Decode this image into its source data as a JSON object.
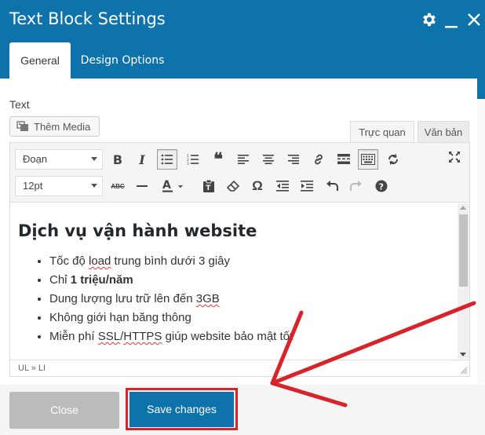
{
  "dialog": {
    "title": "Text Block Settings",
    "tabs": [
      "General",
      "Design Options"
    ]
  },
  "field": {
    "label": "Text"
  },
  "media_button": {
    "label": "Thêm Media",
    "icon": "media-icon"
  },
  "editor_tabs": {
    "visual": "Trực quan",
    "text": "Văn bản"
  },
  "toolbar": {
    "paragraph_format": "Đoạn",
    "font_size": "12pt",
    "row1_icons": [
      "bold-icon",
      "italic-icon",
      "bullet-list-icon",
      "numbered-list-icon",
      "blockquote-icon",
      "align-left-icon",
      "align-center-icon",
      "align-right-icon",
      "link-icon",
      "read-more-icon",
      "toolbar-toggle-icon",
      "refresh-icon",
      "fullscreen-icon"
    ],
    "row2_icons": [
      "strikethrough-icon",
      "horizontal-line-icon",
      "text-color-icon",
      "paste-text-icon",
      "clear-format-icon",
      "special-char-icon",
      "outdent-icon",
      "indent-icon",
      "undo-icon",
      "redo-icon",
      "help-icon"
    ],
    "bold_glyph": "B",
    "italic_glyph": "I",
    "strike_glyph": "ABC",
    "omega_glyph": "Ω",
    "quote_glyph": "❝",
    "help_glyph": "?"
  },
  "content": {
    "heading": "Dịch vụ vận hành website",
    "items": [
      {
        "before": "Tốc độ ",
        "squiggle": "load",
        "after": " trung bình dưới 3 giây"
      },
      {
        "before": "Chỉ ",
        "bold": "1 triệu/năm"
      },
      {
        "before": "Dung lượng lưu trữ lên đến ",
        "squiggle": "3GB"
      },
      {
        "before": "Không giới hạn băng thông"
      },
      {
        "before": "Miễn phí ",
        "squiggle": "SSL",
        "after": "/",
        "squiggle2": "HTTPS",
        "after2": " giúp website bảo mật tốt"
      }
    ]
  },
  "statusbar": {
    "path": "UL » LI"
  },
  "footer": {
    "close_label": "Close",
    "save_label": "Save changes"
  },
  "colors": {
    "header": "#0e73aa",
    "annotation": "#d8232a"
  }
}
